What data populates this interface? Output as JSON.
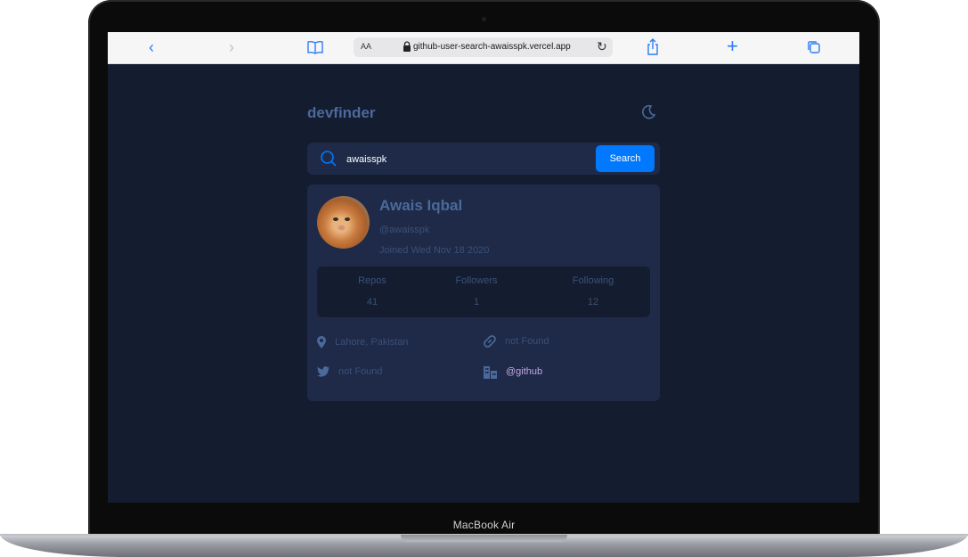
{
  "device": {
    "label": "MacBook Air"
  },
  "browser": {
    "reader_label": "AA",
    "url": "github-user-search-awaisspk.vercel.app",
    "icons": [
      "back-icon",
      "forward-icon",
      "bookmarks-icon",
      "lock-icon",
      "reload-icon",
      "share-icon",
      "new-tab-icon",
      "tabs-icon"
    ]
  },
  "app": {
    "title": "devfinder",
    "theme_icon": "moon-icon",
    "search": {
      "value": "awaisspk",
      "button_label": "Search"
    },
    "user": {
      "name": "Awais Iqbal",
      "login": "@awaisspk",
      "joined": "Joined Wed Nov 18 2020",
      "stats": [
        {
          "label": "Repos",
          "value": "41"
        },
        {
          "label": "Followers",
          "value": "1"
        },
        {
          "label": "Following",
          "value": "12"
        }
      ],
      "location": "Lahore, Pakistan",
      "website": "not Found",
      "twitter": "not Found",
      "company": "@github"
    }
  },
  "colors": {
    "background": "#141c2f",
    "card": "#1e2a47",
    "accent": "#0079ff",
    "muted_text": "#4b6a9b",
    "company_link": "#c2a8e8"
  }
}
